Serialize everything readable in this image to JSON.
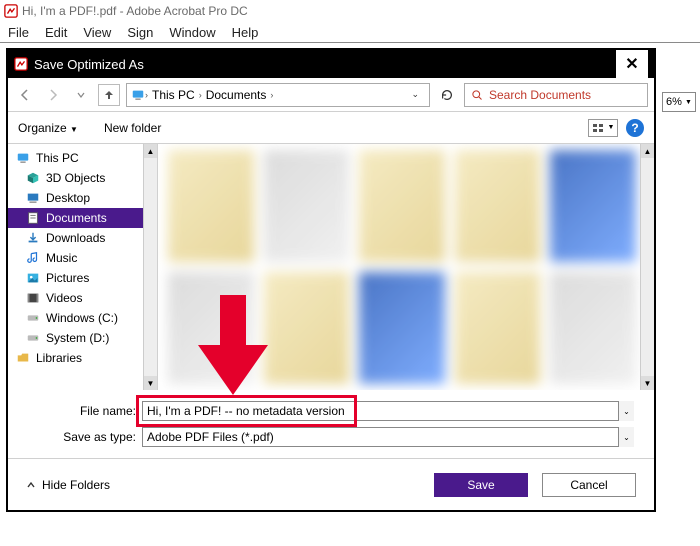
{
  "app": {
    "title": "Hi, I'm a PDF!.pdf - Adobe Acrobat Pro DC",
    "menus": [
      "File",
      "Edit",
      "View",
      "Sign",
      "Window",
      "Help"
    ],
    "zoom": "6%"
  },
  "dialog": {
    "title": "Save Optimized As",
    "breadcrumb": {
      "root": "This PC",
      "folder": "Documents"
    },
    "search_placeholder": "Search Documents",
    "toolbar": {
      "organize": "Organize",
      "new_folder": "New folder"
    },
    "tree": [
      {
        "id": "this-pc",
        "label": "This PC",
        "icon": "monitor",
        "root": true
      },
      {
        "id": "3d-objects",
        "label": "3D Objects",
        "icon": "cube"
      },
      {
        "id": "desktop",
        "label": "Desktop",
        "icon": "desktop"
      },
      {
        "id": "documents",
        "label": "Documents",
        "icon": "doc",
        "selected": true
      },
      {
        "id": "downloads",
        "label": "Downloads",
        "icon": "download"
      },
      {
        "id": "music",
        "label": "Music",
        "icon": "music"
      },
      {
        "id": "pictures",
        "label": "Pictures",
        "icon": "picture"
      },
      {
        "id": "videos",
        "label": "Videos",
        "icon": "video"
      },
      {
        "id": "windows-c",
        "label": "Windows (C:)",
        "icon": "drive"
      },
      {
        "id": "system-d",
        "label": "System (D:)",
        "icon": "drive"
      },
      {
        "id": "libraries",
        "label": "Libraries",
        "icon": "folder",
        "root": true
      }
    ],
    "fields": {
      "filename_label": "File name:",
      "filename_value": "Hi, I'm a PDF! -- no metadata version",
      "savetype_label": "Save as type:",
      "savetype_value": "Adobe PDF Files (*.pdf)"
    },
    "footer": {
      "hide_folders": "Hide Folders",
      "save": "Save",
      "cancel": "Cancel"
    }
  }
}
